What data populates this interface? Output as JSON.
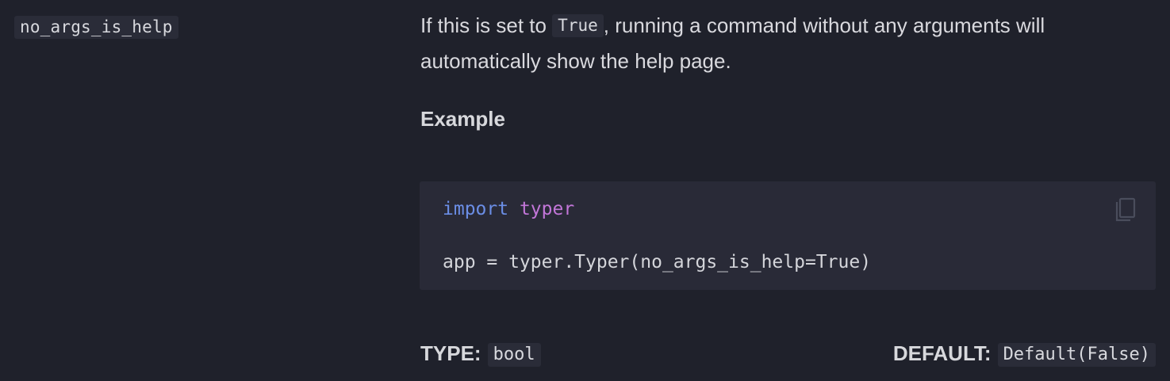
{
  "param": {
    "name": "no_args_is_help"
  },
  "description": {
    "before": "If this is set to ",
    "code": "True",
    "after": ", running a command without any arguments will automatically show the help page."
  },
  "example": {
    "heading": "Example",
    "code": {
      "line1_keyword": "import",
      "line1_module": "typer",
      "line2": "app = typer.Typer(no_args_is_help=True)"
    },
    "copy_icon": "copy-icon"
  },
  "meta": {
    "type_label": "TYPE:",
    "type_value": "bool",
    "default_label": "DEFAULT:",
    "default_value": "Default(False)"
  },
  "colors": {
    "background": "#1f212b",
    "code_background": "#292a37",
    "keyword": "#6b8ee6",
    "module": "#c276d8"
  }
}
